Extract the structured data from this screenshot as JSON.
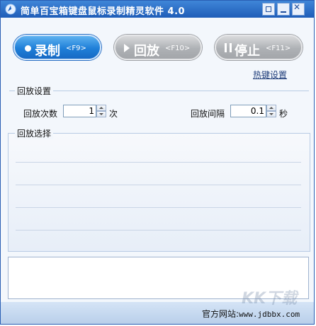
{
  "window": {
    "title": "简单百宝箱键盘鼠标录制精灵软件 4.0"
  },
  "buttons": {
    "record": {
      "label": "录制",
      "key": "<F9>"
    },
    "play": {
      "label": "回放",
      "key": "<F10>"
    },
    "stop": {
      "label": "停止",
      "key": "<F11>"
    }
  },
  "links": {
    "hotkey_settings": "热键设置"
  },
  "playback_settings": {
    "group_title": "回放设置",
    "count_label": "回放次数",
    "count_value": "1",
    "count_unit": "次",
    "interval_label": "回放间隔",
    "interval_value": "0.1",
    "interval_unit": "秒"
  },
  "playback_selection": {
    "group_title": "回放选择"
  },
  "statusbar": {
    "site_label": "官方网站:",
    "site_url": "www.jdbbx.com"
  },
  "watermark": "KK下载",
  "colors": {
    "title_bar": "#1f5db8",
    "record_button": "#1f7fd8",
    "disabled_button": "#aeb1b5",
    "link": "#1f3d7a"
  }
}
